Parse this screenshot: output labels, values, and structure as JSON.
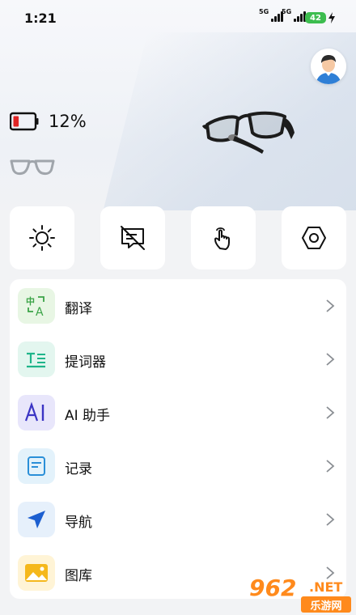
{
  "status_bar": {
    "time": "1:21",
    "network1": "5G",
    "network2": "5G",
    "battery_level": "42",
    "battery_color": "#3dbd4f"
  },
  "device": {
    "battery_percent": "12%",
    "battery_fill_fraction": 0.12,
    "battery_low_color": "#e02424"
  },
  "quick_actions": [
    {
      "icon": "brightness-icon"
    },
    {
      "icon": "display-off-icon"
    },
    {
      "icon": "touch-gesture-icon"
    },
    {
      "icon": "settings-hex-icon"
    }
  ],
  "features": [
    {
      "label": "翻译",
      "icon": "translate-icon",
      "color": "#e8f6e4"
    },
    {
      "label": "提词器",
      "icon": "teleprompter-icon",
      "color": "#e3f6ef"
    },
    {
      "label": "AI 助手",
      "icon": "ai-assistant-icon",
      "color": "#e8e6fb"
    },
    {
      "label": "记录",
      "icon": "notes-icon",
      "color": "#e3f2fb"
    },
    {
      "label": "导航",
      "icon": "navigation-icon",
      "color": "#e6f0fb"
    },
    {
      "label": "图库",
      "icon": "gallery-icon",
      "color": "#fff4d6"
    }
  ],
  "watermark": {
    "number": "962",
    "suffix": ".NET",
    "sub": "乐游网"
  }
}
